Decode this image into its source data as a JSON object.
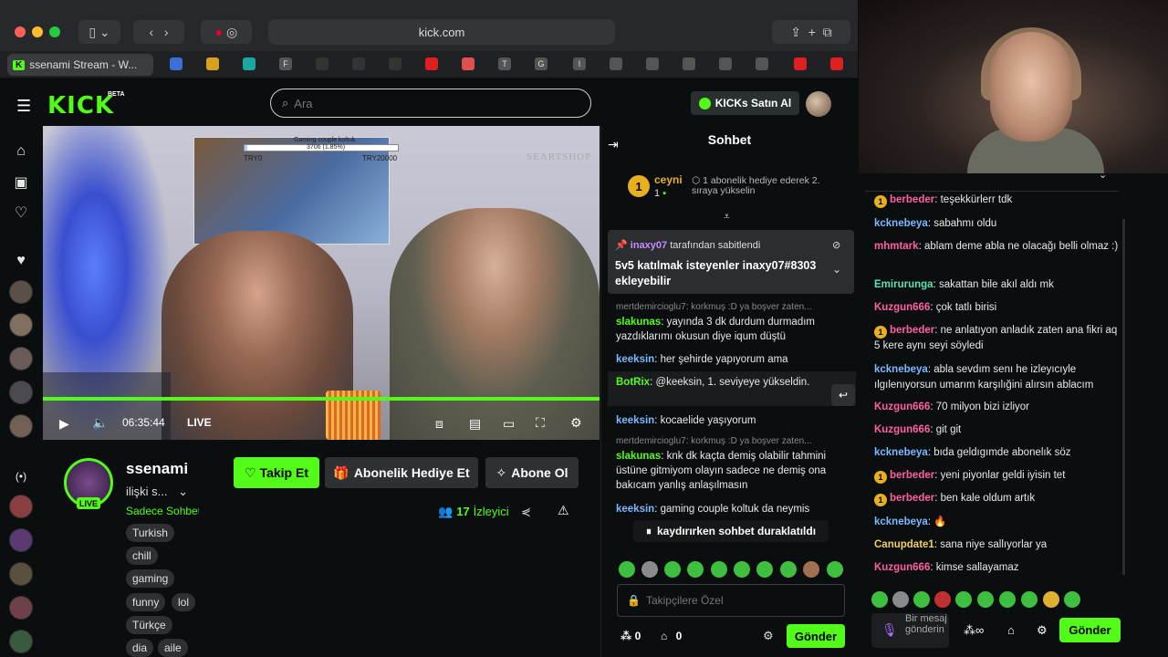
{
  "browser": {
    "url": "kick.com",
    "active_tab": "ssenami Stream - W...",
    "tab_icons": [
      "F",
      "T",
      "G",
      "I"
    ]
  },
  "header": {
    "logo": "KICK",
    "beta": "BETA",
    "search_placeholder": "Ara",
    "kicks_button": "KICKs Satın Al"
  },
  "video": {
    "goal_title": "Gaming couple koltuk",
    "goal_percent": "3706 (1.85%)",
    "goal_start": "TRY0",
    "goal_end": "TRY20000",
    "goal_fraction": 0.0185,
    "timecode": "06:35:44",
    "live": "LIVE",
    "watermark": "SEARTSHOP"
  },
  "channel": {
    "name": "ssenami",
    "live_badge": "LIVE",
    "title": "ilişki s...",
    "category": "Sadece Sohbet",
    "follow": "Takip Et",
    "gift_sub": "Abonelik Hediye Et",
    "subscribe": "Abone Ol",
    "viewers_count": "17",
    "viewers_label": "İzleyici",
    "tags": [
      "Turkish",
      "chill",
      "gaming",
      "funny",
      "lol",
      "Türkçe",
      "dia",
      "aile"
    ]
  },
  "chat": {
    "title": "Sohbet",
    "gifter_name": "ceyni",
    "gifter_count": "1",
    "gifter_rank": "1",
    "gifter_note": "1 abonelik hediye ederek 2. sıraya yükselin",
    "pinned_by": "inaxy07",
    "pinned_by_suffix": "tarafından sabitlendi",
    "pinned_text": "5v5 katılmak isteyenler inaxy07#8303 ekleyebilir",
    "messages": [
      {
        "reply": "mertdemircioglu7: korkmuş :D ya boşver zaten..."
      },
      {
        "user": "slakunas",
        "text": "yayında 3 dk durdum durmadım yazdıklarımı okusun diye iqum düştü"
      },
      {
        "user": "keeksin",
        "text": "her şehirde yapıyorum ama"
      },
      {
        "user": "BotRix",
        "text": "@keeksin, 1. seviyeye yükseldin."
      },
      {
        "user": "keeksin",
        "text": "kocaelide yaşıyorum"
      },
      {
        "reply": "mertdemircioglu7: korkmuş :D ya boşver zaten..."
      },
      {
        "user": "slakunas",
        "text": "knk dk kaçta demiş olabilir tahmini üstüne gitmiyom olayın sadece ne demiş ona bakıcam yanlış anlaşılmasın"
      },
      {
        "user": "keeksin",
        "text": "gaming couple koltuk da neymis"
      }
    ],
    "paused": "kaydırırken sohbet duraklatıldı",
    "input_placeholder": "Takipçilere Özel",
    "points": "0",
    "gifts": "0",
    "send": "Gönder"
  },
  "right_chat": {
    "messages": [
      {
        "user": "berbeder",
        "coin": "1",
        "text": "teşekkürlerr tdk"
      },
      {
        "user": "kcknebeya",
        "text": "sabahmı oldu"
      },
      {
        "user": "mhmtark",
        "text": "ablam deme abla ne olacağı belli olmaz :)"
      },
      {
        "user": "Emirurunga",
        "text": "sakattan bile akıl aldı mk"
      },
      {
        "user": "Kuzgun666",
        "text": "çok tatlı birisi"
      },
      {
        "user": "berbeder",
        "coin": "1",
        "text": "ne anlatıyon anladık zaten ana fikri aq 5 kere aynı seyi söyledi"
      },
      {
        "user": "kcknebeya",
        "text": "abla sevdım senı he izleyıcıyle ılgılenıyorsun umarım karşılığini alırsın ablacım"
      },
      {
        "user": "Kuzgun666",
        "text": "70 milyon bizi izliyor"
      },
      {
        "user": "Kuzgun666",
        "text": "git git"
      },
      {
        "user": "kcknebeya",
        "text": "bıda geldıgımde abonelık söz"
      },
      {
        "user": "berbeder",
        "coin": "1",
        "text": "yeni piyonlar geldi iyisin tet"
      },
      {
        "user": "berbeder",
        "coin": "1",
        "text": "ben kale oldum artık"
      },
      {
        "user": "kcknebeya",
        "text": "🔥"
      },
      {
        "user": "Canupdate1",
        "text": "sana niye sallıyorlar ya"
      },
      {
        "user": "Kuzgun666",
        "text": "kimse sallayamaz"
      }
    ],
    "input_placeholder": "Bir mesaj gönderin",
    "send": "Gönder"
  },
  "colors": {
    "kick_green": "#53fc18",
    "background": "#0b0e0f",
    "button_gray": "#2d3133"
  },
  "icons": [
    "hamburger-icon",
    "home-icon",
    "browse-icon",
    "heart-icon",
    "play-icon",
    "volume-icon",
    "theater-icon",
    "clip-icon",
    "miniplayer-icon",
    "fullscreen-icon",
    "settings-icon",
    "share-icon",
    "warning-icon",
    "pin-icon",
    "collapse-icon",
    "lock-icon",
    "mic-icon",
    "gift-icon",
    "chevron-down-icon"
  ]
}
